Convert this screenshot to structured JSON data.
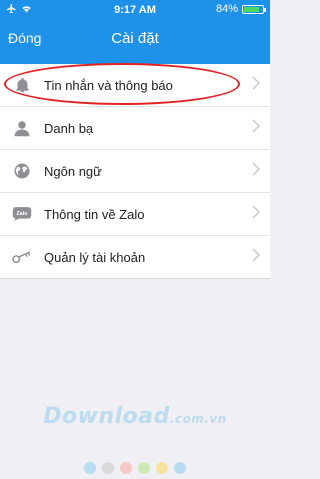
{
  "status_bar": {
    "time": "9:17 AM",
    "battery": "84%",
    "battery_level": 0.84
  },
  "nav": {
    "back_label": "Đóng",
    "title": "Cài đặt"
  },
  "settings": [
    {
      "label": "Tin nhắn và thông báo",
      "icon": "bell-icon"
    },
    {
      "label": "Danh bạ",
      "icon": "person-icon"
    },
    {
      "label": "Ngôn ngữ",
      "icon": "globe-icon"
    },
    {
      "label": "Thông tin về Zalo",
      "icon": "zalo-icon"
    },
    {
      "label": "Quản lý tài khoản",
      "icon": "key-icon"
    }
  ],
  "watermark": {
    "text": "Download",
    "suffix": ".com.vn",
    "dot_colors": [
      "#b7dcf3",
      "#d9d9d9",
      "#f8c8c8",
      "#cfe9b3",
      "#f7e3a0",
      "#b7dcf3"
    ]
  },
  "colors": {
    "header": "#1e92e8",
    "highlight": "#e22424",
    "icon": "#8e8e93"
  }
}
